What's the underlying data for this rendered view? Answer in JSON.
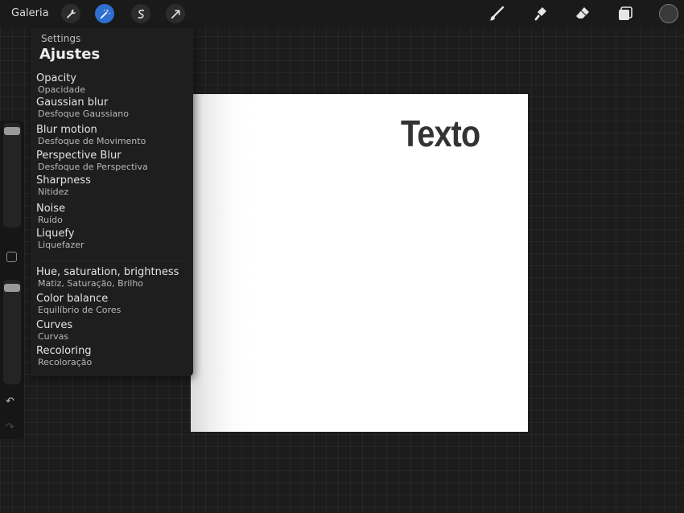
{
  "toolbar": {
    "gallery_label": "Galeria",
    "left_tools": [
      {
        "name": "wrench-icon",
        "active": false
      },
      {
        "name": "magic-wand-icon",
        "active": true
      },
      {
        "name": "selection-icon",
        "active": false
      },
      {
        "name": "transform-arrow-icon",
        "active": false
      }
    ],
    "right_tools": [
      "brush-icon",
      "smudge-icon",
      "eraser-icon",
      "layers-icon"
    ],
    "active_color": "#3a3a3a",
    "accent_color": "#2f6fd1"
  },
  "sidebar": {
    "size_slider_value": 0.95,
    "opacity_slider_value": 0.95,
    "undo_icon": "undo-icon",
    "redo_icon": "redo-icon"
  },
  "adjustments_panel": {
    "subtitle": "Settings",
    "title": "Ajustes",
    "items": [
      {
        "title": "Opacity",
        "subtitle": "Opacidade"
      },
      {
        "title": "Gaussian blur",
        "subtitle": "Desfoque Gaussiano"
      },
      {
        "title": "Blur motion",
        "subtitle": "Desfoque de Movimento"
      },
      {
        "title": "Perspective Blur",
        "subtitle": "Desfoque de Perspectiva"
      },
      {
        "title": "Sharpness",
        "subtitle": "Nitidez"
      },
      {
        "title": "Noise",
        "subtitle": "Ruído"
      },
      {
        "title": "Liquefy",
        "subtitle": "Liquefazer"
      },
      {
        "title": "Hue, saturation, brightness",
        "subtitle": "Matiz, Saturação, Brilho"
      },
      {
        "title": "Color balance",
        "subtitle": "Equilíbrio de Cores"
      },
      {
        "title": "Curves",
        "subtitle": "Curvas"
      },
      {
        "title": "Recoloring",
        "subtitle": "Recoloração"
      }
    ]
  },
  "canvas": {
    "text": "Texto",
    "background": "#ffffff"
  }
}
